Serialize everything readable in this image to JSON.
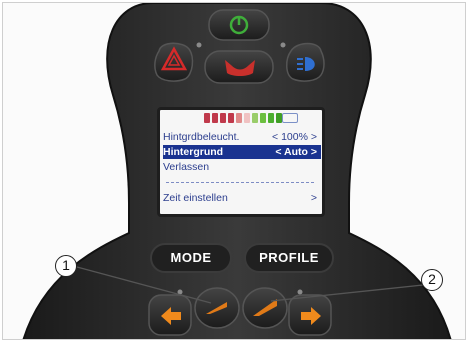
{
  "screen": {
    "battery_colors": [
      "#c0394b",
      "#c0394b",
      "#c0394b",
      "#c0394b",
      "#e08a8a",
      "#f0c2c2",
      "#9acd6a",
      "#6cbf3f",
      "#4cae2e",
      "#3f9e24"
    ],
    "rows": [
      {
        "label": "Hintgrdbeleucht.",
        "value": "< 100% >",
        "selected": false
      },
      {
        "label": "Hintergrund",
        "value": "< Auto >",
        "selected": true
      },
      {
        "label": "Verlassen",
        "value": "",
        "selected": false
      },
      {
        "label": "Zeit einstellen",
        "value": ">",
        "selected": false
      }
    ]
  },
  "buttons": {
    "mode_label": "MODE",
    "profile_label": "PROFILE"
  },
  "callouts": {
    "one": "1",
    "two": "2"
  },
  "colors": {
    "power_green": "#3fae3a",
    "hazard_red": "#d62a2a",
    "horn_red": "#c9302c",
    "light_blue": "#2f6fd1",
    "arrow_orange": "#f08a1c",
    "body": "#262626"
  }
}
